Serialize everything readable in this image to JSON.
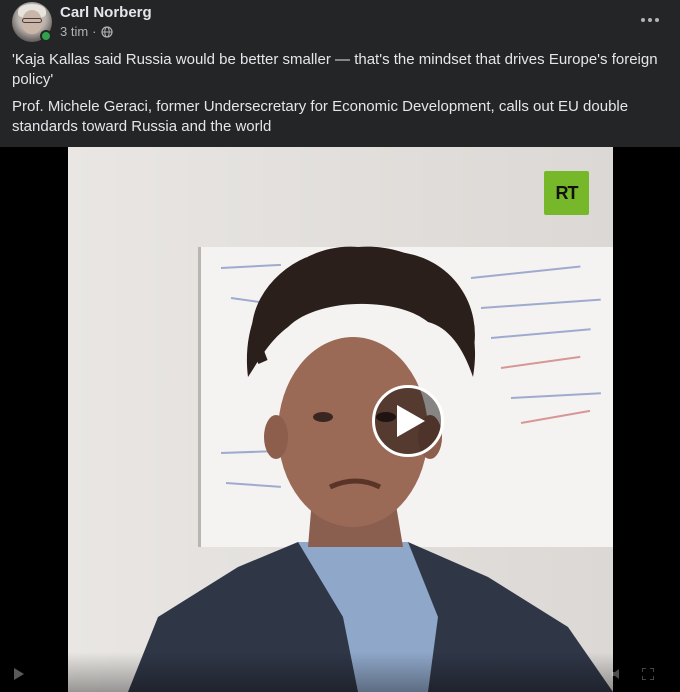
{
  "post": {
    "author": "Carl Norberg",
    "time": "3 tim",
    "separator": "·",
    "privacy_icon": "globe-icon",
    "more_icon": "more-options-icon",
    "paragraph1": "'Kaja Kallas said Russia would be better smaller — that's the mindset that drives Europe's foreign policy'",
    "paragraph2": "Prof. Michele Geraci, former Undersecretary for Economic Development, calls out EU double standards toward Russia and the world"
  },
  "video": {
    "channel_logo": "RT",
    "play_icon": "play-icon",
    "controls": [
      "play-icon",
      "volume-icon",
      "fullscreen-icon"
    ]
  },
  "colors": {
    "background": "#242526",
    "text": "#e4e6eb",
    "secondary_text": "#b0b3b8",
    "online": "#31a24c",
    "rt_green": "#77b82a"
  }
}
